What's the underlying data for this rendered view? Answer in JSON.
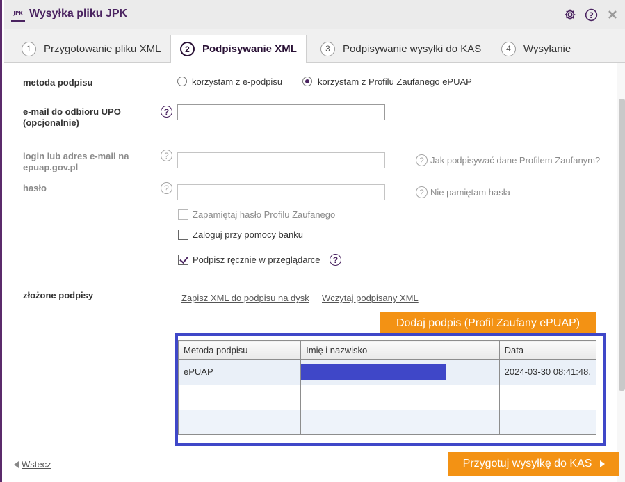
{
  "window": {
    "title": "Wysyłka pliku JPK",
    "logo_text": "JPK"
  },
  "icons": {
    "settings": "gear-icon",
    "help": "question-icon",
    "close": "close-icon"
  },
  "tabs": [
    {
      "num": "1",
      "label": "Przygotowanie pliku XML",
      "active": false
    },
    {
      "num": "2",
      "label": "Podpisywanie XML",
      "active": true
    },
    {
      "num": "3",
      "label": "Podpisywanie wysyłki do KAS",
      "active": false
    },
    {
      "num": "4",
      "label": "Wysyłanie",
      "active": false
    }
  ],
  "form": {
    "method_label": "metoda podpisu",
    "radio_esign": "korzystam z e-podpisu",
    "radio_epuap": "korzystam z Profilu Zaufanego ePUAP",
    "selected_method": "epuap",
    "email_label_1": "e-mail do odbioru UPO",
    "email_label_2": "(opcjonalnie)",
    "email_value": "",
    "login_label_1": "login lub adres e-mail na",
    "login_label_2": "epuap.gov.pl",
    "login_value": "",
    "login_help": "Jak podpisywać dane Profilem Zaufanym?",
    "password_label": "hasło",
    "password_value": "",
    "password_help": "Nie pamiętam hasła",
    "remember_label": "Zapamiętaj hasło Profilu Zaufanego",
    "remember_checked": false,
    "bank_label": "Zaloguj przy pomocy banku",
    "bank_checked": false,
    "manual_label": "Podpisz ręcznie w przeglądarce",
    "manual_checked": true,
    "signatures_label": "złożone podpisy",
    "save_xml_link": "Zapisz XML do podpisu na dysk",
    "load_xml_link": "Wczytaj podpisany XML",
    "add_signature_button": "Dodaj podpis (Profil Zaufany ePUAP)"
  },
  "signatures_table": {
    "columns": [
      "Metoda podpisu",
      "Imię i nazwisko",
      "Data"
    ],
    "rows": [
      [
        "ePUAP",
        "",
        "2024-03-30 08:41:48."
      ],
      [
        "",
        "",
        ""
      ],
      [
        "",
        "",
        ""
      ]
    ]
  },
  "footer": {
    "back_label": "Wstecz",
    "next_button": "Przygotuj wysyłkę do KAS"
  },
  "colors": {
    "brand": "#4a2360",
    "accent": "#f39214",
    "highlight": "#3f47c8"
  }
}
